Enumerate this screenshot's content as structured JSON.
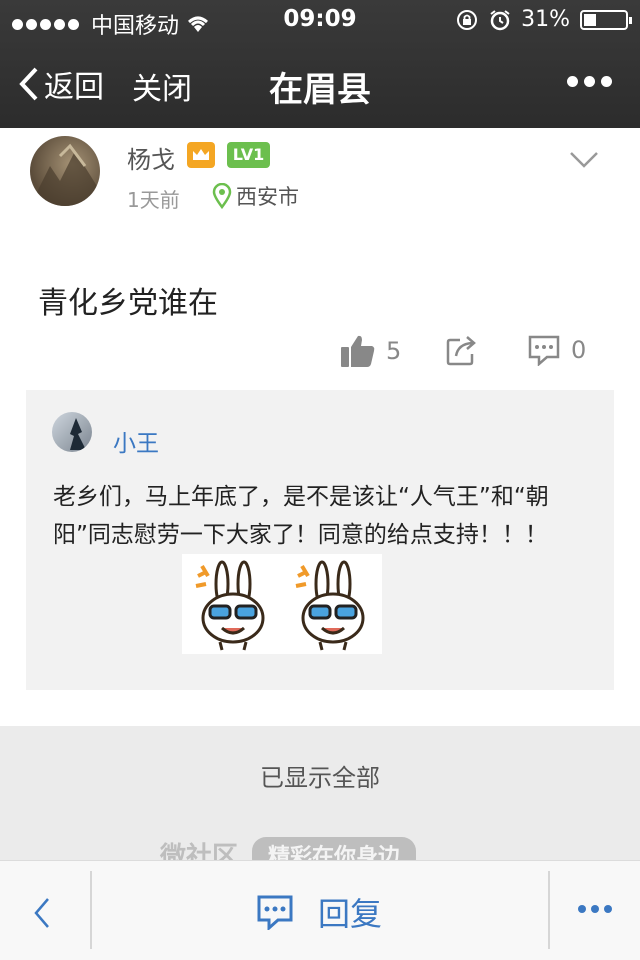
{
  "status_bar": {
    "carrier": "中国移动",
    "time": "09:09",
    "battery_text": "31%",
    "battery_level": 0.31
  },
  "nav": {
    "back_label": "返回",
    "close_label": "关闭",
    "title": "在眉县"
  },
  "post": {
    "author": "杨戈",
    "level_badge": "LV1",
    "time_ago": "1天前",
    "location": "西安市",
    "content": "青化乡党谁在",
    "likes": "5",
    "comments": "0"
  },
  "comment": {
    "author": "小王",
    "text": "老乡们，马上年底了，是不是该让“人气王”和“朝阳”同志慰劳一下大家了！同意的给点支持！！！"
  },
  "footer": {
    "all_shown": "已显示全部",
    "brand_left": "微社区",
    "brand_right": "精彩在你身边"
  },
  "toolbar": {
    "reply_label": "回复"
  },
  "icons": {
    "wifi": "wifi-icon",
    "lock": "orientation-lock-icon",
    "alarm": "alarm-icon",
    "crown": "crown-icon",
    "location": "location-pin-icon",
    "like": "thumbs-up-icon",
    "share": "share-icon",
    "comment": "comment-icon"
  },
  "colors": {
    "accent_blue": "#3b78c2",
    "crown_orange": "#f4a623",
    "level_green": "#6cbf4e",
    "location_green": "#6cbf4e"
  }
}
